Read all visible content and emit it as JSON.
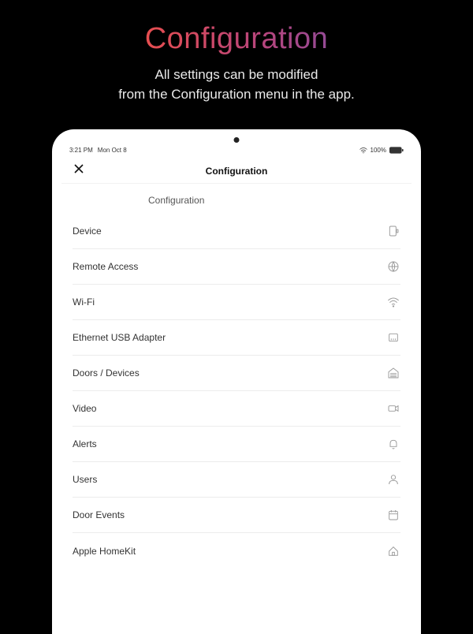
{
  "hero": {
    "title": "Configuration",
    "sub_line1": "All settings can be modified",
    "sub_line2": "from the Configuration menu in the app."
  },
  "status": {
    "time": "3:21 PM",
    "date": "Mon Oct 8",
    "battery": "100%"
  },
  "nav": {
    "title": "Configuration",
    "close_icon": "close-icon"
  },
  "section": {
    "label": "Configuration"
  },
  "menu": {
    "items": [
      {
        "label": "Device"
      },
      {
        "label": "Remote Access"
      },
      {
        "label": "Wi-Fi"
      },
      {
        "label": "Ethernet USB Adapter"
      },
      {
        "label": "Doors / Devices"
      },
      {
        "label": "Video"
      },
      {
        "label": "Alerts"
      },
      {
        "label": "Users"
      },
      {
        "label": "Door Events"
      },
      {
        "label": "Apple HomeKit"
      }
    ]
  }
}
